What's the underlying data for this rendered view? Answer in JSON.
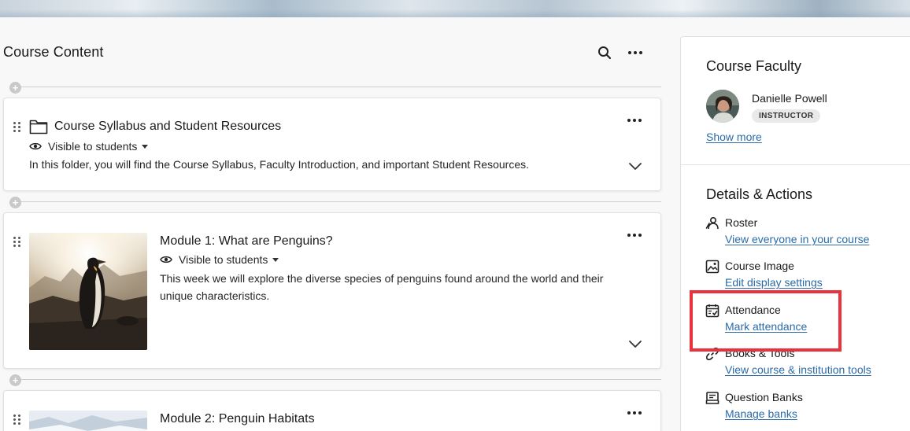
{
  "header": {
    "title": "Course Content",
    "search_icon": "search-icon",
    "more_icon": "more-options-icon"
  },
  "items": [
    {
      "title": "Course Syllabus and Student Resources",
      "icon": "folder-icon",
      "visibility": "Visible to students",
      "description": "In this folder, you will find the Course Syllabus, Faculty Introduction, and important Student Resources."
    },
    {
      "title": "Module 1: What are Penguins?",
      "visibility": "Visible to students",
      "description": "This week we will explore the diverse species of penguins found around the world and their unique characteristics."
    },
    {
      "title": "Module 2: Penguin Habitats"
    }
  ],
  "panel": {
    "faculty_heading": "Course Faculty",
    "faculty_name": "Danielle Powell",
    "faculty_role": "INSTRUCTOR",
    "show_more": "Show more",
    "details_heading": "Details & Actions",
    "actions": [
      {
        "label": "Roster",
        "link": "View everyone in your course",
        "icon": "roster-icon"
      },
      {
        "label": "Course Image",
        "link": "Edit display settings",
        "icon": "image-icon"
      },
      {
        "label": "Attendance",
        "link": "Mark attendance",
        "icon": "attendance-icon"
      },
      {
        "label": "Books & Tools",
        "link": "View course & institution tools",
        "icon": "link-icon"
      },
      {
        "label": "Question Banks",
        "link": "Manage banks",
        "icon": "question-bank-icon"
      }
    ]
  },
  "colors": {
    "link": "#2a6ba8",
    "highlight": "#e8323c"
  }
}
